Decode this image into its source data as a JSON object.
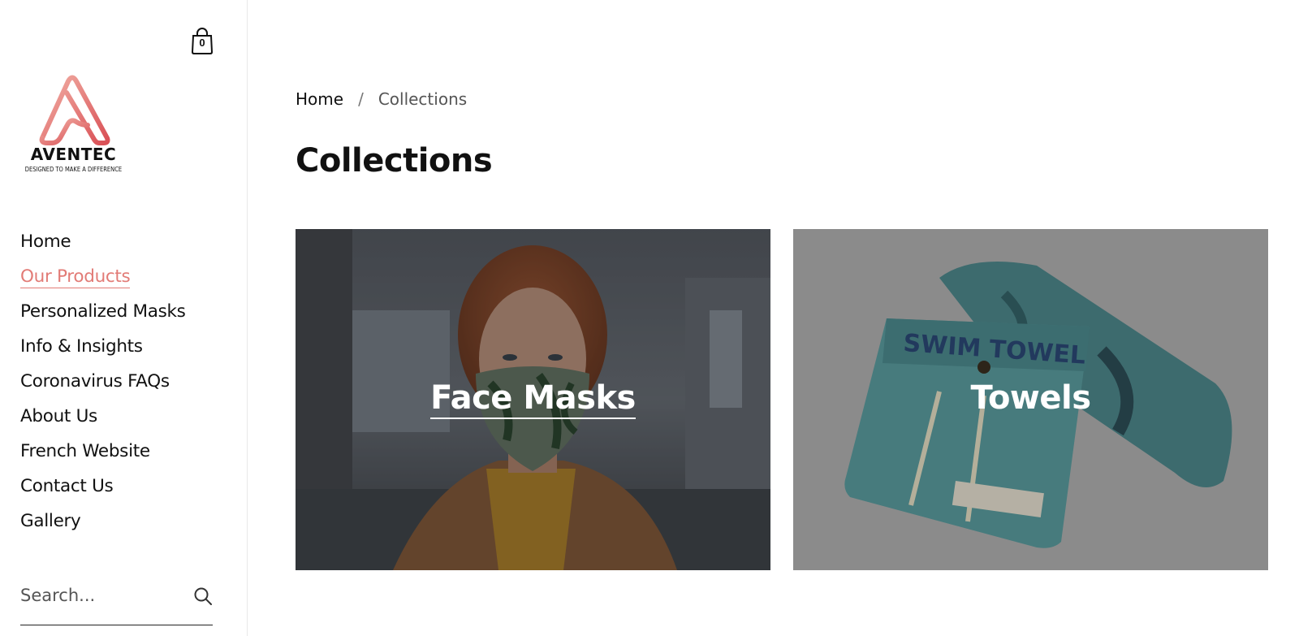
{
  "header": {
    "cart_count": "0"
  },
  "brand": {
    "name": "AVENTEC",
    "tagline": "DESIGNED TO MAKE A DIFFERENCE",
    "accent_color": "#e27b76"
  },
  "nav": {
    "items": [
      {
        "label": "Home",
        "active": false
      },
      {
        "label": "Our Products",
        "active": true
      },
      {
        "label": "Personalized Masks",
        "active": false
      },
      {
        "label": "Info & Insights",
        "active": false
      },
      {
        "label": "Coronavirus FAQs",
        "active": false
      },
      {
        "label": "About Us",
        "active": false
      },
      {
        "label": "French Website",
        "active": false
      },
      {
        "label": "Contact Us",
        "active": false
      },
      {
        "label": "Gallery",
        "active": false
      }
    ]
  },
  "search": {
    "placeholder": "Search..."
  },
  "breadcrumb": {
    "home": "Home",
    "separator": "/",
    "current": "Collections"
  },
  "main": {
    "title": "Collections",
    "collections": [
      {
        "label": "Face Masks"
      },
      {
        "label": "Towels"
      }
    ]
  }
}
